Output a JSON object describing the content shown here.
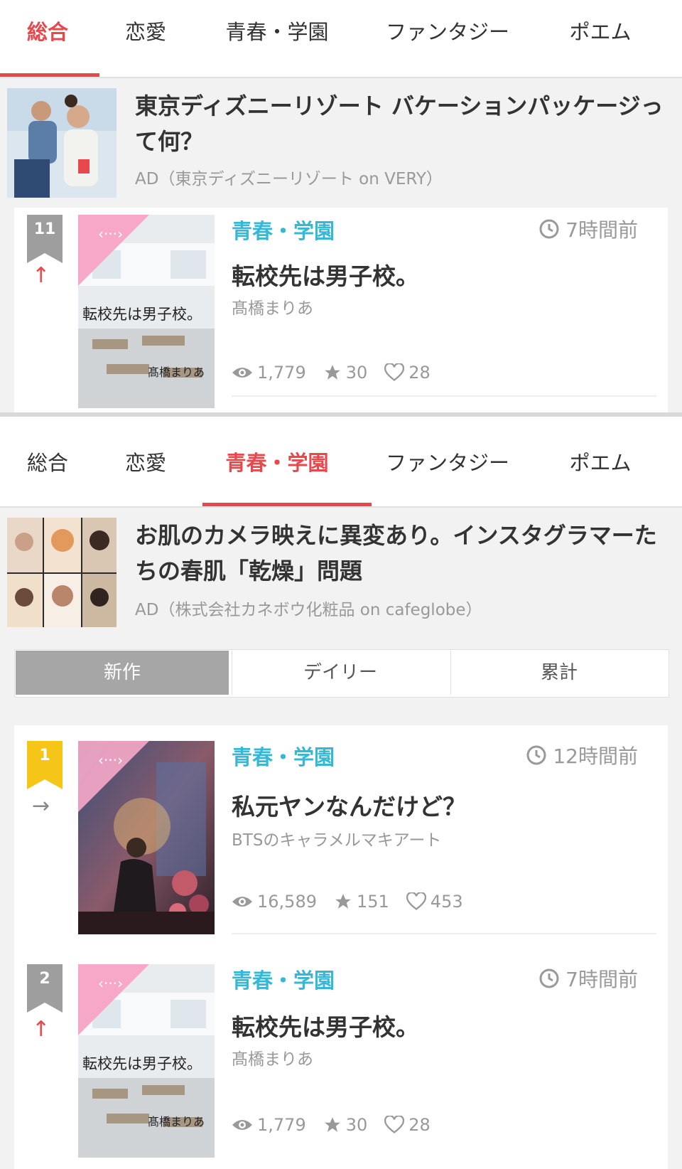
{
  "screen1": {
    "tabs": [
      {
        "label": "総合",
        "active": true
      },
      {
        "label": "恋愛",
        "active": false
      },
      {
        "label": "青春・学園",
        "active": false
      },
      {
        "label": "ファンタジー",
        "active": false
      },
      {
        "label": "ポエム",
        "active": false
      }
    ],
    "ad": {
      "title": "東京ディズニーリゾート バケーションパッケージって何？",
      "source": "AD（東京ディズニーリゾート on VERY）"
    },
    "card": {
      "rank": "11",
      "rank_color": "#9e9e9e",
      "trend": "↑",
      "genre": "青春・学園",
      "time": "7時間前",
      "title": "転校先は男子校。",
      "author": "髙橋まりあ",
      "views": "1,779",
      "stars": "30",
      "likes": "28",
      "cover_title": "転校先は男子校。",
      "cover_author": "髙橋まりあ"
    }
  },
  "screen2": {
    "tabs": [
      {
        "label": "総合",
        "active": false
      },
      {
        "label": "恋愛",
        "active": false
      },
      {
        "label": "青春・学園",
        "active": true
      },
      {
        "label": "ファンタジー",
        "active": false
      },
      {
        "label": "ポエム",
        "active": false
      }
    ],
    "ad": {
      "title": "お肌のカメラ映えに異変あり。インスタグラマーたちの春肌「乾燥」問題",
      "source": "AD（株式会社カネボウ化粧品 on cafeglobe）"
    },
    "segments": [
      {
        "label": "新作",
        "active": true
      },
      {
        "label": "デイリー",
        "active": false
      },
      {
        "label": "累計",
        "active": false
      }
    ],
    "cards": [
      {
        "rank": "1",
        "rank_color": "#f5c518",
        "trend": "→",
        "genre": "青春・学園",
        "time": "12時間前",
        "title": "私元ヤンなんだけど？",
        "author": "BTSのキャラメルマキアート",
        "views": "16,589",
        "stars": "151",
        "likes": "453"
      },
      {
        "rank": "2",
        "rank_color": "#9e9e9e",
        "trend": "↑",
        "genre": "青春・学園",
        "time": "7時間前",
        "title": "転校先は男子校。",
        "author": "髙橋まりあ",
        "views": "1,779",
        "stars": "30",
        "likes": "28",
        "cover_title": "転校先は男子校。",
        "cover_author": "髙橋まりあ"
      }
    ]
  },
  "colors": {
    "accent": "#e8474c",
    "genre": "#34b8d6",
    "muted": "#999999",
    "corner_ribbon": "#f7a8c8"
  },
  "icons": [
    "clock-icon",
    "eye-icon",
    "star-icon",
    "heart-icon",
    "code-badge-icon",
    "ribbon-icon"
  ]
}
